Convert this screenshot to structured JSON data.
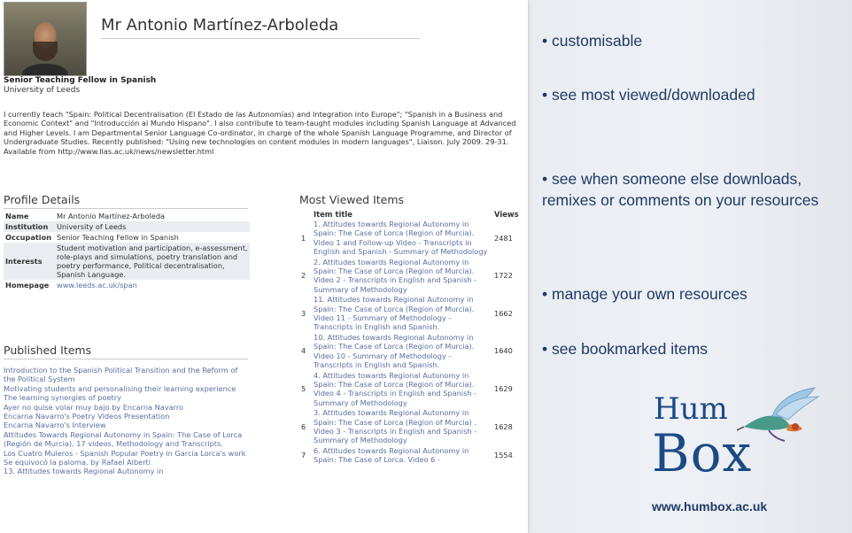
{
  "profile": {
    "name": "Mr Antonio Martínez-Arboleda",
    "title": "Senior Teaching Fellow in Spanish",
    "institution": "University of Leeds",
    "bio": "I currently teach \"Spain: Political Decentralisation (El Estado de las Autonomías) and Integration into Europe\"; \"Spanish in a Business and Economic Context\" and \"Introducción al Mundo Hispano\". I also contribute to team-taught modules including Spanish Language at Advanced and Higher Levels. I am Departmental Senior Language Co-ordinator, in charge of the whole Spanish Language Programme, and Director of Undergraduate Studies. Recently published: \"Using new technologies on content modules in modern languages\", Liaison. July 2009. 29-31. Available from http://www.llas.ac.uk/news/newsletter.html"
  },
  "profile_details": {
    "heading": "Profile Details",
    "rows": [
      {
        "key": "Name",
        "value": "Mr Antonio Martínez-Arboleda"
      },
      {
        "key": "Institution",
        "value": "University of Leeds"
      },
      {
        "key": "Occupation",
        "value": "Senior Teaching Fellow in Spanish"
      },
      {
        "key": "Interests",
        "value": "Student motivation and participation, e-assessment, role-plays and simulations, poetry translation and poetry performance, Political decentralisation, Spanish Language."
      },
      {
        "key": "Homepage",
        "value": "www.leeds.ac.uk/span"
      }
    ]
  },
  "published_items": {
    "heading": "Published Items",
    "items": [
      "Introduction to the Spanish Political Transition and the Reform of the Political System",
      "Motivating students and personalising their learning experience",
      "The learning synergies of poetry",
      "Ayer no quise volar muy bajo by Encarna Navarro",
      "Encarna Navarro's Poetry Videos Presentation",
      "Encarna Navarro's Interview",
      "Attitudes Towards Regional Autonomy in Spain: The Case of Lorca (Región de Murcia). 17 videos, Methodology and Transcripts.",
      "Los Cuatro Muleros - Spanish Popular Poetry in García Lorca's work",
      "Se equivocó la paloma, by Rafael Alberti",
      "13. Attitudes towards Regional Autonomy in"
    ]
  },
  "most_viewed": {
    "heading": "Most Viewed Items",
    "col_title": "Item title",
    "col_views": "Views",
    "rows": [
      {
        "n": "1",
        "title": "1. Attitudes towards Regional Autonomy in Spain: The Case of Lorca (Region of Murcia). Video 1 and Follow-up Video - Transcripts in English and Spanish - Summary of Methodology",
        "views": "2481"
      },
      {
        "n": "2",
        "title": "2. Attitudes towards Regional Autonomy in Spain: The Case of Lorca (Region of Murcia). Video 2 - Transcripts in English and Spanish - Summary of Methodology",
        "views": "1722"
      },
      {
        "n": "3",
        "title": "11. Attitudes towards Regional Autonomy in Spain: The Case of Lorca (Region of Murcia). Video 11 - Summary of Methodology - Transcripts in English and Spanish.",
        "views": "1662"
      },
      {
        "n": "4",
        "title": "10. Attitudes towards Regional Autonomy in Spain: The Case of Lorca (Region of Murcia). Video 10 - Summary of Methodology - Transcripts in English and Spanish.",
        "views": "1640"
      },
      {
        "n": "5",
        "title": "4. Attitudes towards Regional Autonomy in Spain: The Case of Lorca (Region of Murcia). Video 4 - Transcripts in English and Spanish - Summary of Methodology",
        "views": "1629"
      },
      {
        "n": "6",
        "title": "3. Attitudes towards Regional Autonomy in Spain: The Case of Lorca (Region of Murcia) . Video 3 - Transcripts in English and Spanish - Summary of Methodology",
        "views": "1628"
      },
      {
        "n": "7",
        "title": "6. Attitudes towards Regional Autonomy in Spain: The Case of Lorca. Video 6 -",
        "views": "1554"
      }
    ]
  },
  "slide_bullets": [
    "• customisable",
    "• see most viewed/downloaded",
    "• see when someone else downloads, remixes or comments on your resources",
    "• manage your own resources",
    "• see bookmarked items"
  ],
  "logo": {
    "word1": "Hum",
    "word2": "Box",
    "url": "www.humbox.ac.uk",
    "icon": "hummingbird-icon"
  }
}
